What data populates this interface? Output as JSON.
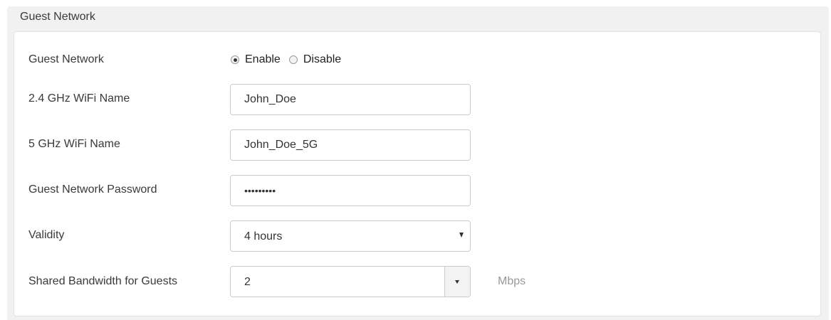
{
  "section": {
    "title": "Guest Network"
  },
  "guest_network": {
    "label": "Guest Network",
    "options": [
      {
        "label": "Enable",
        "checked": true
      },
      {
        "label": "Disable",
        "checked": false
      }
    ]
  },
  "wifi_24": {
    "label": "2.4 GHz WiFi Name",
    "value": "John_Doe"
  },
  "wifi_5": {
    "label": "5 GHz WiFi Name",
    "value": "John_Doe_5G"
  },
  "password": {
    "label": "Guest Network Password",
    "masked_value": "•••••••••"
  },
  "validity": {
    "label": "Validity",
    "selected": "4 hours"
  },
  "bandwidth": {
    "label": "Shared Bandwidth for Guests",
    "value": "2",
    "unit": "Mbps"
  }
}
